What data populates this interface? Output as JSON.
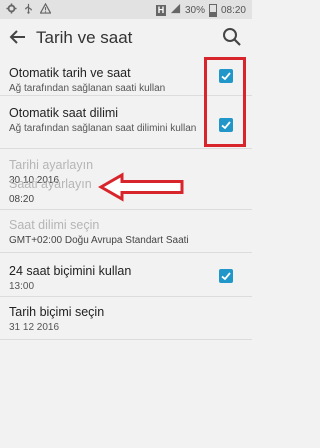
{
  "status_bar": {
    "left_icons": [
      "settings-gear-icon",
      "usb-icon",
      "warning-icon"
    ],
    "right_icons": [
      "h-network-icon",
      "signal-bars-icon",
      "battery-icon"
    ],
    "battery_percent": "30%",
    "time": "08:20",
    "h_label": "H"
  },
  "header": {
    "title": "Tarih ve saat",
    "back_icon": "arrow-left-icon",
    "search_icon": "search-icon"
  },
  "settings": [
    {
      "title": "Otomatik tarih ve saat",
      "subtitle": "Ağ tarafından sağlanan saati kullan",
      "checkbox": true,
      "checked": true,
      "enabled": true
    },
    {
      "title": "Otomatik saat dilimi",
      "subtitle": "Ağ tarafından sağlanan saat dilimini kullan",
      "checkbox": true,
      "checked": true,
      "enabled": true
    },
    {
      "title": "Tarihi ayarlayın",
      "subtitle": "30 10 2016",
      "enabled": false
    },
    {
      "title": "Saati ayarlayın",
      "subtitle": "08:20",
      "enabled": false
    },
    {
      "title": "Saat dilimi seçin",
      "subtitle": "GMT+02:00 Doğu Avrupa Standart Saati",
      "enabled": false
    },
    {
      "title": "24 saat biçimini kullan",
      "subtitle": "13:00",
      "checkbox": true,
      "checked": true,
      "enabled": true
    },
    {
      "title": "Tarih biçimi seçin",
      "subtitle": "31 12 2016",
      "enabled": true
    }
  ],
  "annotations": {
    "highlight_color": "#d8252b",
    "accent_color": "#2196c9"
  }
}
